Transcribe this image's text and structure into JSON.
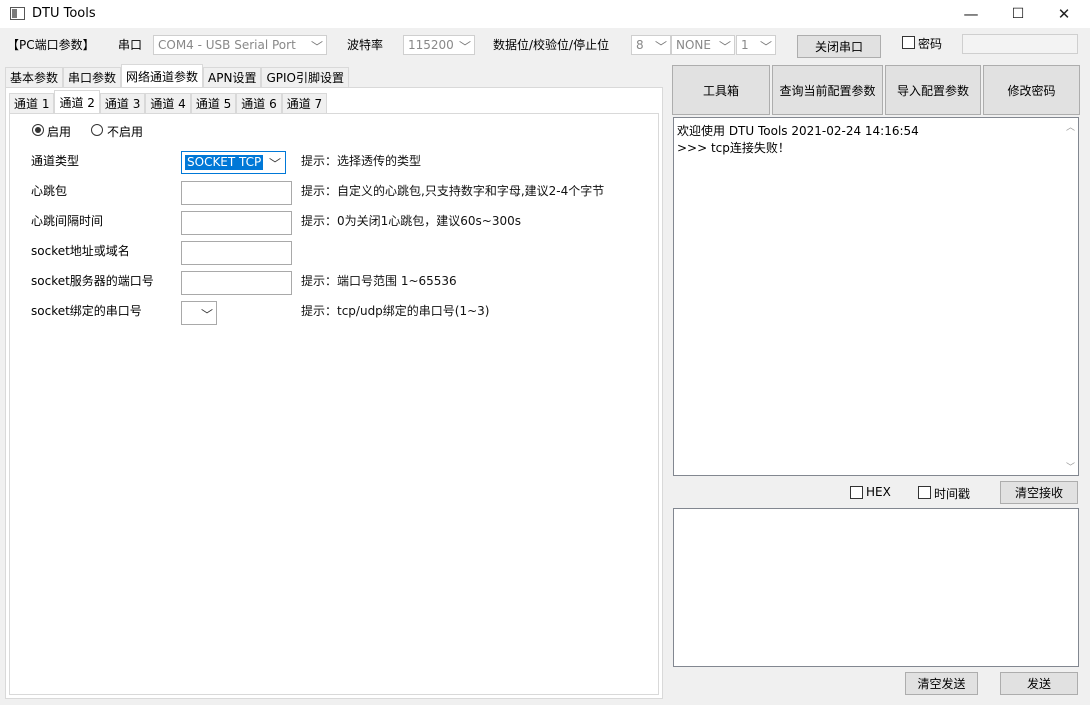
{
  "window": {
    "title": "DTU Tools",
    "minimize": "—",
    "maximize": "☐",
    "close": "✕"
  },
  "toolbar": {
    "section_label": "【PC端口参数】",
    "port_label": "串口",
    "port_value": "COM4 - USB Serial Port",
    "baud_label": "波特率",
    "baud_value": "115200",
    "data_label": "数据位/校验位/停止位",
    "data_bits": "8",
    "parity": "NONE",
    "stop_bits": "1",
    "close_port_button": "关闭串口",
    "password_checkbox_label": "密码",
    "password_value": ""
  },
  "main_tabs": [
    {
      "label": "基本参数"
    },
    {
      "label": "串口参数"
    },
    {
      "label": "网络通道参数"
    },
    {
      "label": "APN设置"
    },
    {
      "label": "GPIO引脚设置"
    }
  ],
  "channel_tabs": [
    {
      "label": "通道 1"
    },
    {
      "label": "通道 2"
    },
    {
      "label": "通道 3"
    },
    {
      "label": "通道 4"
    },
    {
      "label": "通道 5"
    },
    {
      "label": "通道 6"
    },
    {
      "label": "通道 7"
    }
  ],
  "channel": {
    "enable_label": "启用",
    "disable_label": "不启用",
    "enabled": true,
    "type_label": "通道类型",
    "type_value": "SOCKET TCP",
    "type_hint": "提示：选择透传的类型",
    "heartbeat_label": "心跳包",
    "heartbeat_value": "",
    "heartbeat_hint": "提示：自定义的心跳包,只支持数字和字母,建议2-4个字节",
    "interval_label": "心跳间隔时间",
    "interval_value": "",
    "interval_hint": "提示：0为关闭1心跳包，建议60s~300s",
    "address_label": "socket地址或域名",
    "address_value": "",
    "server_port_label": "socket服务器的端口号",
    "server_port_value": "",
    "server_port_hint": "提示：端口号范围 1~65536",
    "bind_label": "socket绑定的串口号",
    "bind_value": "",
    "bind_hint": "提示：tcp/udp绑定的串口号(1~3)"
  },
  "actions": {
    "toolbox": "工具箱",
    "query_config": "查询当前配置参数",
    "import_config": "导入配置参数",
    "change_password": "修改密码"
  },
  "receive": {
    "lines": [
      "欢迎使用 DTU Tools 2021-02-24 14:16:54",
      ">>> tcp连接失败！"
    ],
    "hex_label": "HEX",
    "timestamp_label": "时间戳",
    "clear_button": "清空接收"
  },
  "send": {
    "text": "",
    "clear_button": "清空发送",
    "send_button": "发送"
  }
}
